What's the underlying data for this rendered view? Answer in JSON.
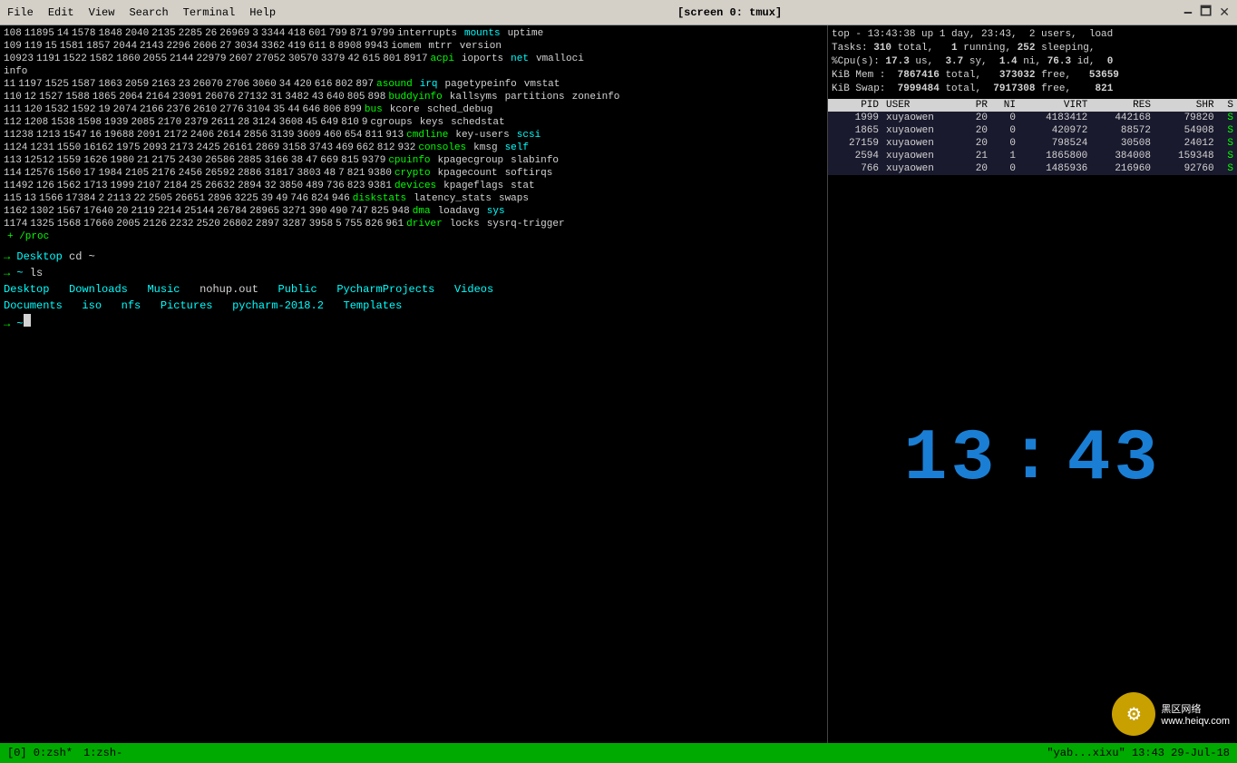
{
  "titlebar": {
    "title": "[screen 0: tmux]",
    "menu_items": [
      "File",
      "Edit",
      "View",
      "Search",
      "Terminal",
      "Help"
    ],
    "minimize": "🗕",
    "maximize": "🗖",
    "close": "✕"
  },
  "left_pane": {
    "proc_rows": [
      {
        "cols": [
          "108",
          "11895",
          "14",
          "1578",
          "1848",
          "2040",
          "2135",
          "2285",
          "26",
          "26969",
          "3",
          "3344",
          "418",
          "601",
          "799",
          "871",
          "9799",
          "interrupts",
          "mounts",
          "uptime"
        ]
      },
      {
        "cols": [
          "109",
          "119",
          "15",
          "1581",
          "1857",
          "2044",
          "2143",
          "2296",
          "2606",
          "27",
          "3034",
          "3362",
          "419",
          "611",
          "8",
          "8908",
          "9943",
          "iomem",
          "mtrr",
          "version"
        ]
      },
      {
        "cols": [
          "10923",
          "1191",
          "1522",
          "1582",
          "1860",
          "2055",
          "2144",
          "22979",
          "2607",
          "27052",
          "30570",
          "3379",
          "42",
          "615",
          "801",
          "8917",
          "",
          "acpi",
          "ioports",
          "net",
          "vmalloci"
        ]
      },
      {
        "cols_special": "info"
      },
      {
        "cols": [
          "11",
          "1197",
          "1525",
          "1587",
          "1863",
          "2059",
          "2163",
          "23",
          "26070",
          "2706",
          "3060",
          "34",
          "420",
          "616",
          "802",
          "897",
          "",
          "asound",
          "irq",
          "pagetypeinfo",
          "vmstat"
        ]
      },
      {
        "cols": [
          "110",
          "12",
          "1527",
          "1588",
          "1865",
          "2064",
          "2164",
          "23091",
          "26076",
          "27132",
          "31",
          "3482",
          "43",
          "640",
          "805",
          "898",
          "",
          "buddyinfo",
          "kallsyms",
          "partitions",
          "zoneinfo"
        ]
      },
      {
        "cols": [
          "111",
          "120",
          "1532",
          "1592",
          "19",
          "2074",
          "2166",
          "2376",
          "2610",
          "2776",
          "3104",
          "35",
          "44",
          "646",
          "806",
          "899",
          "",
          "bus",
          "kcore",
          "sched_debug",
          ""
        ]
      },
      {
        "cols": [
          "112",
          "1208",
          "1538",
          "1598",
          "1939",
          "2085",
          "2170",
          "2379",
          "2611",
          "28",
          "3124",
          "3608",
          "45",
          "649",
          "810",
          "9",
          "",
          "cgroups",
          "keys",
          "schedstat",
          ""
        ]
      },
      {
        "cols": [
          "11238",
          "1213",
          "1547",
          "16",
          "19688",
          "2091",
          "2172",
          "2406",
          "2614",
          "2856",
          "3139",
          "3609",
          "460",
          "654",
          "811",
          "913",
          "",
          "cmdline",
          "key-users",
          "scsi",
          ""
        ]
      },
      {
        "cols": [
          "1124",
          "1231",
          "1550",
          "16162",
          "1975",
          "2093",
          "2173",
          "2425",
          "26161",
          "2869",
          "3158",
          "3743",
          "469",
          "662",
          "812",
          "932",
          "",
          "consoles",
          "kmsg",
          "self",
          ""
        ]
      },
      {
        "cols": [
          "113",
          "12512",
          "1559",
          "1626",
          "1980",
          "21",
          "2175",
          "2430",
          "26586",
          "2885",
          "3166",
          "38",
          "47",
          "669",
          "815",
          "9379",
          "",
          "cpuinfo",
          "kpagecgroup",
          "slabinfo",
          ""
        ]
      },
      {
        "cols": [
          "114",
          "12576",
          "1560",
          "17",
          "1984",
          "2105",
          "2176",
          "2456",
          "26592",
          "2886",
          "31817",
          "3803",
          "48",
          "7",
          "821",
          "9380",
          "",
          "crypto",
          "kpagecount",
          "softirqs",
          ""
        ]
      },
      {
        "cols": [
          "11492",
          "126",
          "1562",
          "1713",
          "1999",
          "2107",
          "2184",
          "25",
          "26632",
          "2894",
          "32",
          "3850",
          "489",
          "736",
          "823",
          "9381",
          "",
          "devices",
          "kpageflags",
          "stat",
          ""
        ]
      },
      {
        "cols": [
          "115",
          "13",
          "1566",
          "17384",
          "2",
          "2113",
          "22",
          "2505",
          "26651",
          "2896",
          "3225",
          "39",
          "49",
          "746",
          "824",
          "946",
          "",
          "diskstats",
          "latency_stats",
          "swaps",
          ""
        ]
      },
      {
        "cols": [
          "1162",
          "1302",
          "1567",
          "17640",
          "20",
          "2119",
          "2214",
          "25144",
          "26784",
          "28965",
          "3271",
          "390",
          "490",
          "747",
          "825",
          "948",
          "",
          "dma",
          "loadavg",
          "sys",
          ""
        ]
      },
      {
        "cols": [
          "1174",
          "1325",
          "1568",
          "17660",
          "2005",
          "2126",
          "2232",
          "2520",
          "26802",
          "2897",
          "3287",
          "3958",
          "5",
          "755",
          "826",
          "961",
          "",
          "driver",
          "locks",
          "sysrq-trigger",
          ""
        ]
      },
      {
        "special": "+ /proc"
      }
    ],
    "shell_lines": [
      {
        "type": "prompt",
        "arrow": "→",
        "dir": "Desktop",
        "cmd": "cd ~"
      },
      {
        "type": "prompt",
        "arrow": "→",
        "dir": "~",
        "cmd": "ls"
      },
      {
        "type": "ls_output1",
        "items": [
          "Desktop",
          "Downloads",
          "Music",
          "nohup.out",
          "Public",
          "PycharmProjects",
          "Videos"
        ]
      },
      {
        "type": "ls_output2",
        "items": [
          "Documents",
          "iso",
          "nfs",
          "Pictures",
          "pycharm-2018.2",
          "Templates"
        ]
      },
      {
        "type": "prompt_cursor",
        "arrow": "→",
        "dir": "~"
      }
    ]
  },
  "right_pane": {
    "top_info": {
      "line1": "top - 13:43:38 up 1 day, 23:43,  2 users,  load",
      "line2": "Tasks: 310 total,   1 running, 252 sleeping,",
      "line3": "%Cpu(s): 17.3 us,  3.7 sy,  1.4 ni, 76.3 id,  0",
      "line4": "KiB Mem :  7867416 total,   373032 free,   53659",
      "line5": "KiB Swap:  7999484 total,  7917308 free,    821"
    },
    "proc_table": {
      "headers": [
        "PID",
        "USER",
        "PR",
        "NI",
        "VIRT",
        "RES",
        "SHR",
        "S"
      ],
      "rows": [
        {
          "pid": "1999",
          "user": "xuyaowen",
          "pr": "20",
          "ni": "0",
          "virt": "4183412",
          "res": "442168",
          "shr": "79820",
          "s": "S"
        },
        {
          "pid": "1865",
          "user": "xuyaowen",
          "pr": "20",
          "ni": "0",
          "virt": "420972",
          "res": "88572",
          "shr": "54908",
          "s": "S"
        },
        {
          "pid": "27159",
          "user": "xuyaowen",
          "pr": "20",
          "ni": "0",
          "virt": "798524",
          "res": "30508",
          "shr": "24012",
          "s": "S"
        },
        {
          "pid": "2594",
          "user": "xuyaowen",
          "pr": "21",
          "ni": "1",
          "virt": "1865800",
          "res": "384008",
          "shr": "159348",
          "s": "S"
        },
        {
          "pid": "766",
          "user": "xuyaowen",
          "pr": "20",
          "ni": "0",
          "virt": "1485936",
          "res": "216960",
          "shr": "92760",
          "s": "S"
        }
      ]
    },
    "clock": "13:43",
    "watermark": {
      "site": "黑区网络",
      "url": "www.heiqv.com"
    }
  },
  "statusbar": {
    "tabs": [
      "[0] 0:zsh*",
      "1:zsh-"
    ],
    "right_info": "\"yab...xixu\" 13:43 29-Jul-18"
  }
}
